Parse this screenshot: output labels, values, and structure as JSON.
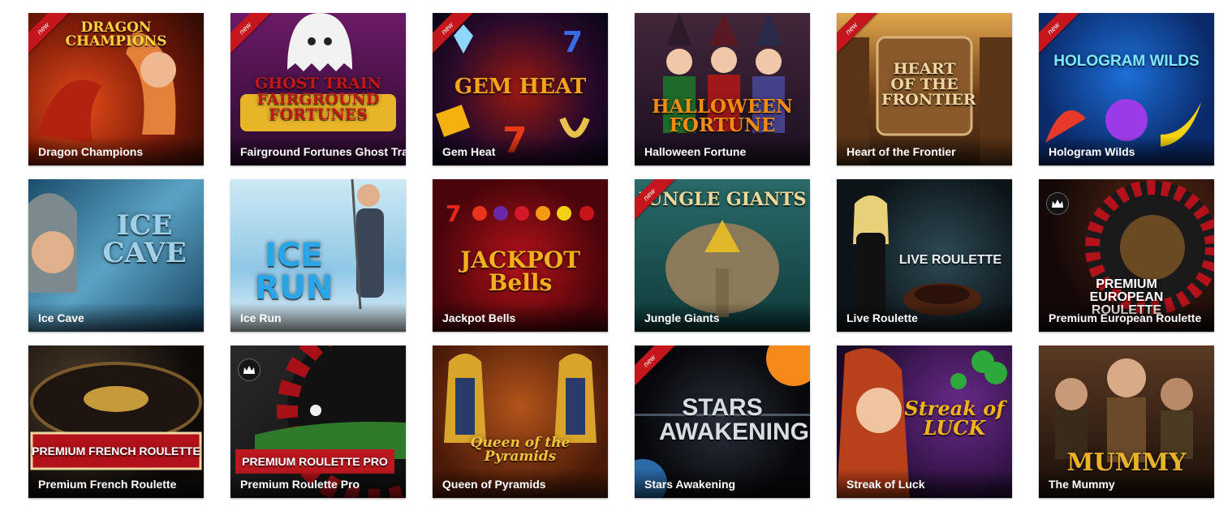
{
  "games": [
    {
      "name": "Dragon Champions",
      "art": "DRAGON CHAMPIONS",
      "badge": "new"
    },
    {
      "name": "Fairground Fortunes Ghost Train",
      "art": "GHOST TRAIN FAIRGROUND FORTUNES",
      "badge": "new"
    },
    {
      "name": "Gem Heat",
      "art": "GEM HEAT",
      "badge": "new"
    },
    {
      "name": "Halloween Fortune",
      "art": "HALLOWEEN FORTUNE",
      "badge": null
    },
    {
      "name": "Heart of the Frontier",
      "art": "HEART OF THE FRONTIER",
      "badge": "new"
    },
    {
      "name": "Hologram Wilds",
      "art": "HOLOGRAM WILDS",
      "badge": "new"
    },
    {
      "name": "Ice Cave",
      "art": "ICE CAVE",
      "badge": null
    },
    {
      "name": "Ice Run",
      "art": "ICE RUN",
      "badge": null
    },
    {
      "name": "Jackpot Bells",
      "art": "JACKPOT Bells",
      "badge": null
    },
    {
      "name": "Jungle Giants",
      "art": "JUNGLE GIANTS",
      "badge": "new"
    },
    {
      "name": "Live Roulette",
      "art": "LIVE ROULETTE",
      "badge": null
    },
    {
      "name": "Premium European Roulette",
      "art": "PREMIUM EUROPEAN ROULETTE",
      "badge": "crown"
    },
    {
      "name": "Premium French Roulette",
      "art": "PREMIUM FRENCH ROULETTE",
      "badge": null
    },
    {
      "name": "Premium Roulette Pro",
      "art": "PREMIUM ROULETTE PRO",
      "badge": "crown"
    },
    {
      "name": "Queen of Pyramids",
      "art": "Queen of the Pyramids",
      "badge": null
    },
    {
      "name": "Stars Awakening",
      "art": "STARS AWAKENING",
      "badge": "new"
    },
    {
      "name": "Streak of Luck",
      "art": "Streak of LUCK",
      "badge": null
    },
    {
      "name": "The Mummy",
      "art": "MUMMY",
      "badge": null
    }
  ],
  "badge_label": "new",
  "colors": {
    "ribbon": "#c4161c",
    "caption_text": "#ffffff",
    "background": "#ffffff"
  }
}
